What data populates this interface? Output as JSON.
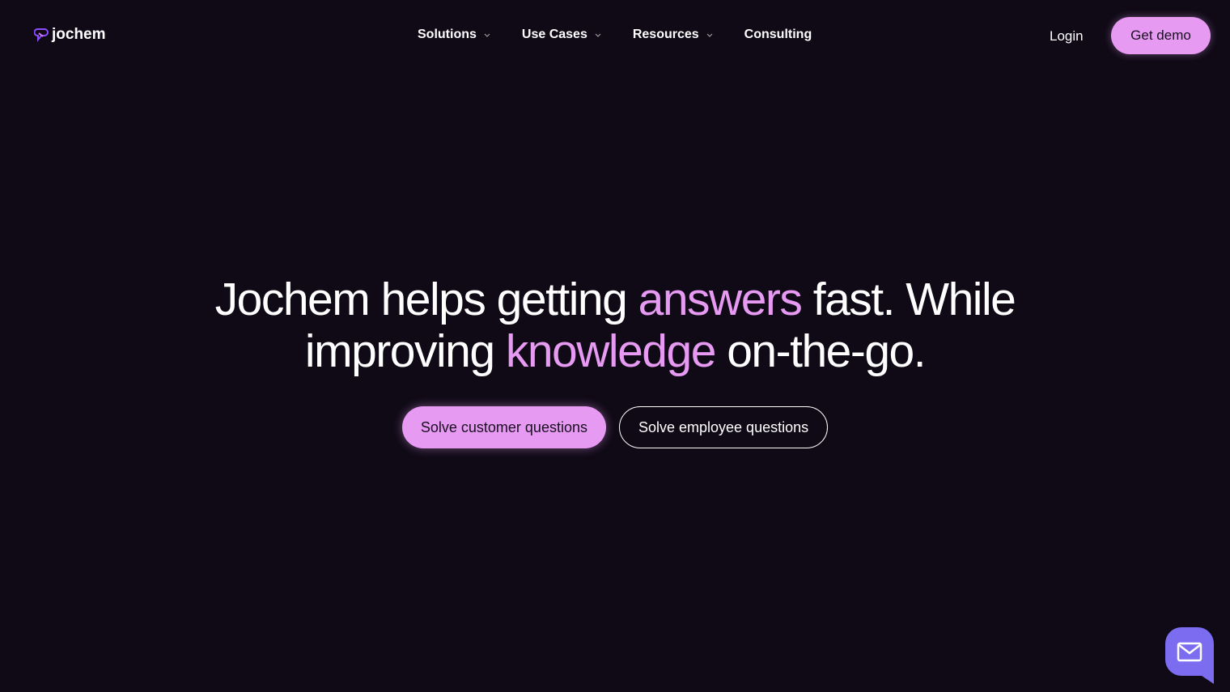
{
  "brand": {
    "name": "jochem",
    "accent": "#e79af2",
    "chat_color": "#7b6cf0"
  },
  "nav": {
    "items": [
      {
        "label": "Solutions",
        "dropdown": true
      },
      {
        "label": "Use Cases",
        "dropdown": true
      },
      {
        "label": "Resources",
        "dropdown": true
      },
      {
        "label": "Consulting",
        "dropdown": false
      }
    ],
    "login": "Login",
    "demo": "Get demo"
  },
  "hero": {
    "t1": "Jochem helps getting ",
    "t2": "answers",
    "t3": " fast. While",
    "t4": "improving ",
    "t5": "knowledge",
    "t6": " on-the-go.",
    "cta_primary": "Solve customer questions",
    "cta_secondary": "Solve employee questions"
  },
  "chat": {
    "icon": "mail-icon"
  }
}
